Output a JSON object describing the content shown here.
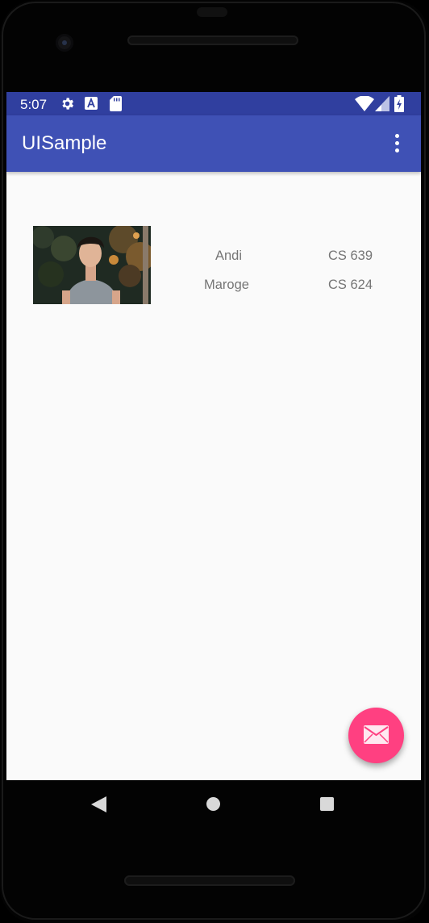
{
  "status_bar": {
    "time": "5:07",
    "left_icons": [
      "settings-gear-icon",
      "font-a-icon",
      "sd-card-icon"
    ],
    "right_icons": [
      "wifi-icon",
      "cell-signal-icon",
      "battery-charging-icon"
    ],
    "color": "#303f9f"
  },
  "toolbar": {
    "title": "UISample",
    "color": "#3f51b5",
    "menu_icon": "overflow-menu-icon"
  },
  "content": {
    "photo": "portrait-photo-icon",
    "rows": [
      {
        "name": "Andi",
        "course": "CS 639"
      },
      {
        "name": "Maroge",
        "course": "CS 624"
      }
    ]
  },
  "fab": {
    "icon": "email-icon",
    "color": "#ff4081"
  },
  "navigation": [
    "back-icon",
    "home-icon",
    "recents-icon"
  ]
}
